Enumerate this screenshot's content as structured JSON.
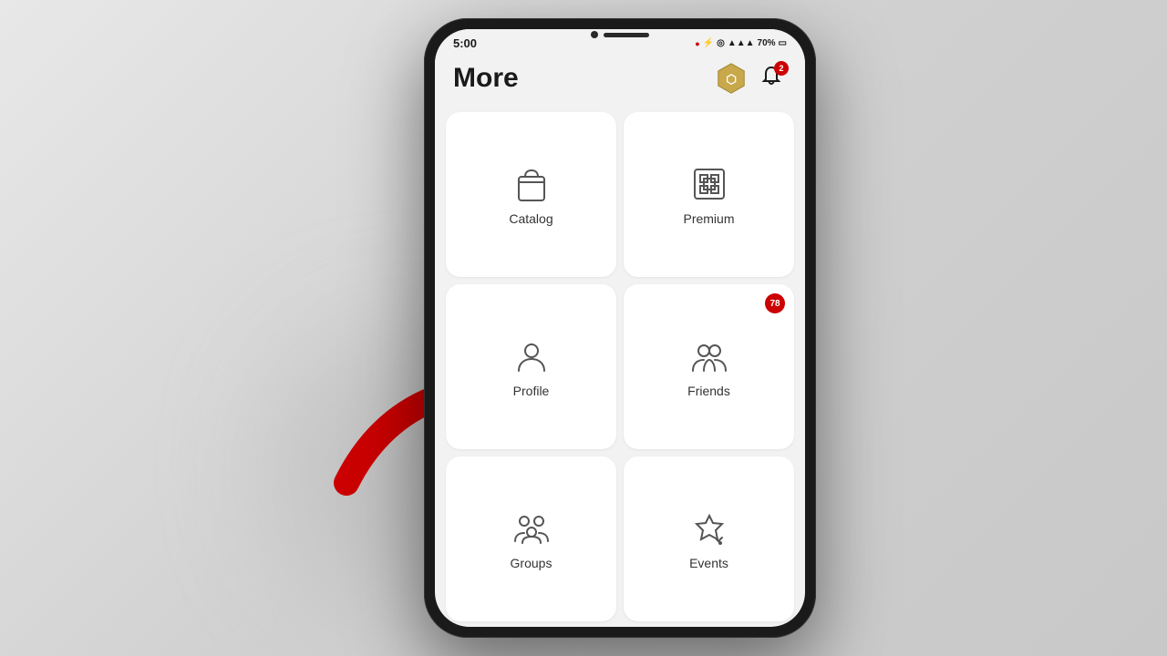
{
  "background": {
    "color": "#d4d4d4"
  },
  "phone": {
    "status_bar": {
      "time": "5:00",
      "battery": "70%",
      "recording_dot": "●"
    },
    "header": {
      "title": "More",
      "notification_badge": "2"
    },
    "grid_items": [
      {
        "id": "catalog",
        "label": "Catalog",
        "icon": "bag-icon",
        "badge": null
      },
      {
        "id": "premium",
        "label": "Premium",
        "icon": "premium-icon",
        "badge": null
      },
      {
        "id": "profile",
        "label": "Profile",
        "icon": "profile-icon",
        "badge": null
      },
      {
        "id": "friends",
        "label": "Friends",
        "icon": "friends-icon",
        "badge": "78"
      },
      {
        "id": "groups",
        "label": "Groups",
        "icon": "groups-icon",
        "badge": null
      },
      {
        "id": "events",
        "label": "Events",
        "icon": "events-icon",
        "badge": null
      }
    ]
  },
  "arrow": {
    "color": "#cc0000",
    "points_to": "profile"
  }
}
